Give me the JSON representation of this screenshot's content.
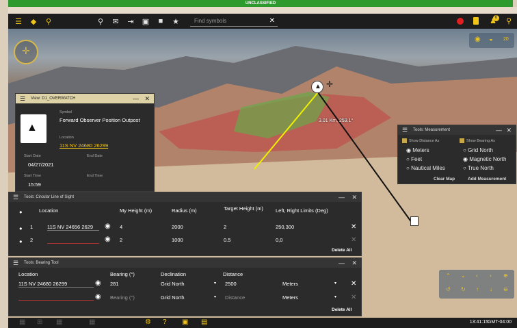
{
  "classification": "UNCLASSIFIED",
  "toolbar": {
    "search_placeholder": "Find symbols",
    "search_clear": "✕",
    "left_icons": [
      "menu-icon",
      "layers-icon",
      "place-icon"
    ],
    "center_icons": [
      "pin-icon",
      "message-icon",
      "route-icon",
      "clipboard-icon",
      "folder-icon",
      "star-icon"
    ],
    "right_icons": [
      "record-icon",
      "notebook-icon",
      "notifications-icon",
      "search-icon"
    ],
    "notification_count": "0",
    "accent": "#f0c419"
  },
  "map": {
    "distance_label": "3.01 Km, 259.1°",
    "zoom_level": "20"
  },
  "view_panel": {
    "title": "View: D1_OVERWATCH",
    "symbol_label": "Symbol",
    "symbol_name": "Forward Observer Position Outpost",
    "location_label": "Location",
    "location_value": "11S NV 24680 26299",
    "start_date_label": "Start Date",
    "start_date": "04/27/2021",
    "end_date_label": "End Date",
    "start_time_label": "Start Time",
    "start_time": "15:59",
    "end_time_label": "End Time"
  },
  "measurement": {
    "title": "Tools: Measurement",
    "show_distance": "Show Distance As",
    "show_bearing": "Show Bearing As",
    "distance_options": [
      "Meters",
      "Feet",
      "Nautical Miles"
    ],
    "bearing_options": [
      "Grid North",
      "Magnetic North",
      "True North"
    ],
    "distance_selected": 0,
    "bearing_selected": 1,
    "clear_map": "Clear Map",
    "add_measurement": "Add Measurement"
  },
  "clos": {
    "title": "Tools: Circular Line of Sight",
    "headers": [
      "Location",
      "My Height (m)",
      "Radius (m)",
      "Target Height (m)",
      "Left, Right Limits (Deg)"
    ],
    "rows": [
      {
        "num": "1",
        "location": "11S NV 24656 2629",
        "my_height": "4",
        "radius": "2000",
        "target_height": "2",
        "limits": "250,300"
      },
      {
        "num": "2",
        "location": "",
        "my_height": "2",
        "radius": "1000",
        "target_height": "0.5",
        "limits": "0,0"
      }
    ],
    "delete_all": "Delete All"
  },
  "bearing": {
    "title": "Tools: Bearing Tool",
    "headers": [
      "Location",
      "Bearing (°)",
      "Declination",
      "Distance"
    ],
    "rows": [
      {
        "location": "11S NV 24680 26299",
        "bearing": "281",
        "declination": "Grid North",
        "distance": "2500",
        "units": "Meters"
      },
      {
        "location": "",
        "bearing": "Bearing (°)",
        "declination": "Grid North",
        "distance": "Distance",
        "units": "Meters"
      }
    ],
    "delete_all": "Delete All"
  },
  "statusbar": {
    "time": "13:41:15",
    "timezone": "GMT-04:00"
  }
}
